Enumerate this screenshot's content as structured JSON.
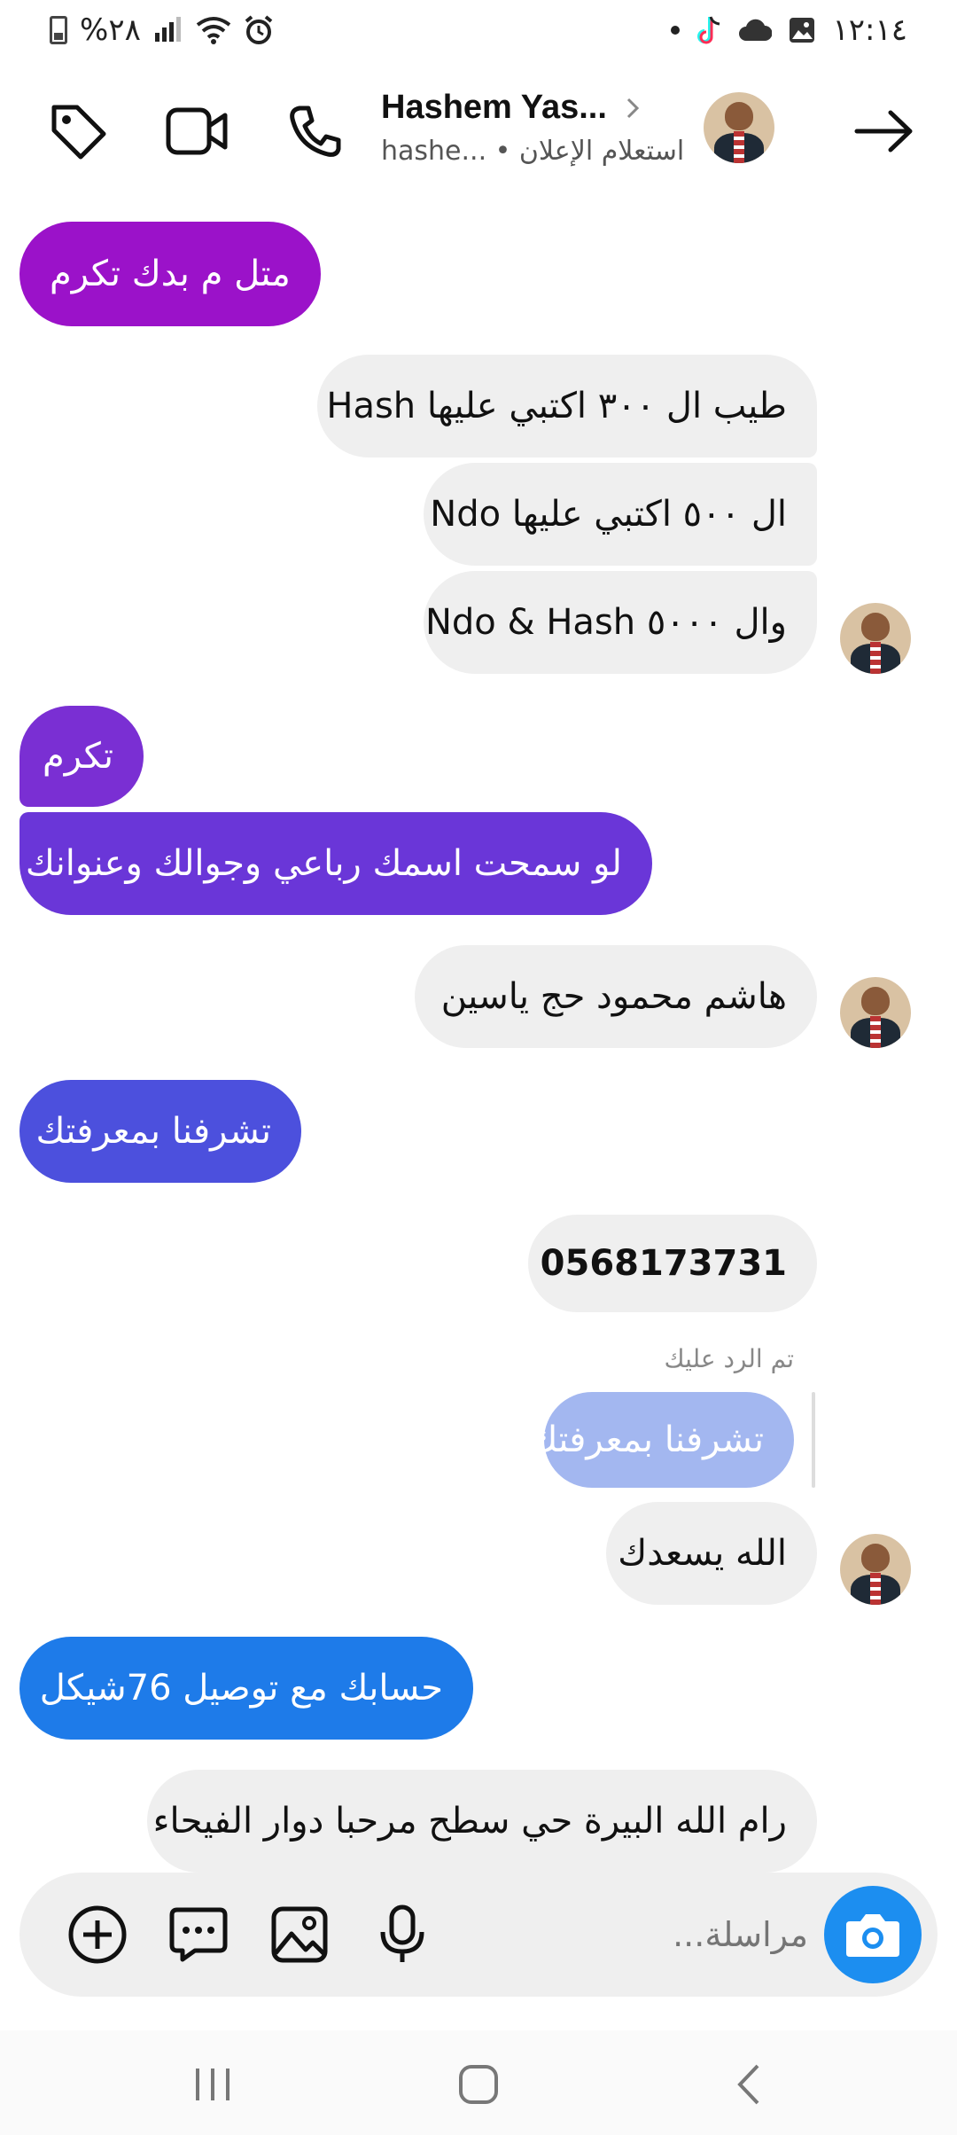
{
  "status_bar": {
    "time": "١٢:١٤",
    "battery": "%٢٨"
  },
  "header": {
    "contact_name": "Hashem Yas...",
    "contact_sub": "hashe... • استعلام الإعلان"
  },
  "messages": [
    {
      "dir": "out",
      "text": "متل م بدك تكرم",
      "color": "#9b12c9"
    },
    {
      "dir": "in",
      "text": "طيب ال ٣٠٠ اكتبي عليها Hash"
    },
    {
      "dir": "in",
      "text": "ال ٥٠٠ اكتبي عليها Ndo"
    },
    {
      "dir": "in",
      "text": "وال ٥٠٠٠ Ndo & Hash"
    },
    {
      "dir": "out",
      "text": "تكرم",
      "color": "#7a2fd3"
    },
    {
      "dir": "out",
      "text": "لو سمحت اسمك رباعي وجوالك وعنوانك",
      "color": "#6a36d8"
    },
    {
      "dir": "in",
      "text": "هاشم محمود حج ياسين"
    },
    {
      "dir": "out",
      "text": "تشرفنا بمعرفتك",
      "color": "#4c50dd"
    },
    {
      "dir": "in",
      "text": "0568173731"
    },
    {
      "dir": "in",
      "text": "الله يسعدك"
    },
    {
      "dir": "out",
      "text": "حسابك مع توصيل 76شيكل",
      "color": "#1e7be9"
    },
    {
      "dir": "in",
      "text": "رام الله البيرة حي سطح مرحبا دوار الفيحاء"
    }
  ],
  "reply": {
    "note": "تم الرد عليك",
    "quoted_text": "تشرفنا بمعرفتك",
    "quoted_color": "#a3b7f0"
  },
  "composer": {
    "placeholder": "مراسلة..."
  },
  "colors": {
    "incoming_bubble": "#efefef",
    "camera_button": "#1c8ef0"
  },
  "icons": [
    "tag-icon",
    "video-call-icon",
    "phone-icon",
    "chevron-right-icon",
    "arrow-right-icon",
    "camera-icon",
    "plus-circle-icon",
    "chat-bubble-icon",
    "image-icon",
    "microphone-icon"
  ]
}
